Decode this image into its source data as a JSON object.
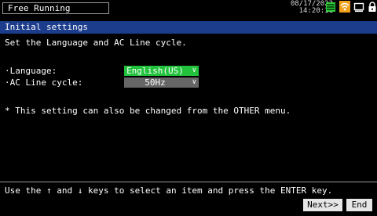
{
  "header": {
    "mode": "Free Running",
    "date": "08/17/2023",
    "time": "14:20:11",
    "icons": [
      "memory-card-icon",
      "wifi-icon",
      "monitor-icon",
      "lock-icon"
    ],
    "accent": "#1c3c8c"
  },
  "screen": {
    "title": "Initial settings",
    "instruction": "Set the Language and AC Line cycle.",
    "language_label": "·Language:",
    "language_value": "English(US)",
    "ac_label": "·AC Line cycle:",
    "ac_value": "50Hz",
    "note": "* This setting can also be changed from the OTHER menu."
  },
  "footer": {
    "hint_prefix": "Use the",
    "hint_up": "↑",
    "hint_mid": "and",
    "hint_down": "↓",
    "hint_suffix": "keys to select an item and press the ENTER key.",
    "next_label": "Next>>",
    "end_label": "End"
  },
  "colors": {
    "selected_field": "#23c23d",
    "field": "#666666"
  }
}
